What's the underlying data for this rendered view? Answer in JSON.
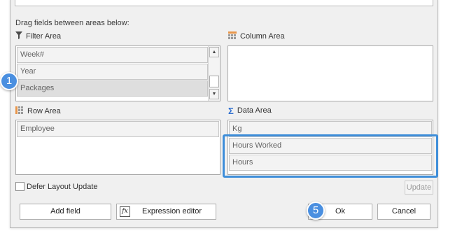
{
  "dialog": {
    "hint": "Drag fields between areas below:"
  },
  "filter_area": {
    "label": "Filter Area",
    "icon": "filter-funnel-icon",
    "fields": [
      "Week#",
      "Year",
      "Packages"
    ],
    "selected_field": "Packages"
  },
  "column_area": {
    "label": "Column Area",
    "icon": "column-grid-icon",
    "fields": []
  },
  "row_area": {
    "label": "Row Area",
    "icon": "row-grid-icon",
    "fields": [
      "Employee"
    ]
  },
  "data_area": {
    "label": "Data Area",
    "icon": "sigma-icon",
    "fields": [
      "Kg",
      "Hours Worked",
      "Hours"
    ]
  },
  "defer_layout": {
    "label": "Defer Layout Update",
    "checked": false
  },
  "buttons": {
    "update": "Update",
    "add_field": "Add field",
    "expression_editor": "Expression editor",
    "ok": "Ok",
    "cancel": "Cancel"
  },
  "callouts": {
    "step1": "1",
    "step5": "5"
  },
  "colors": {
    "accent": "#3e8ed9",
    "badge": "#4a8fe0",
    "grid_icon": "#e8964a"
  }
}
